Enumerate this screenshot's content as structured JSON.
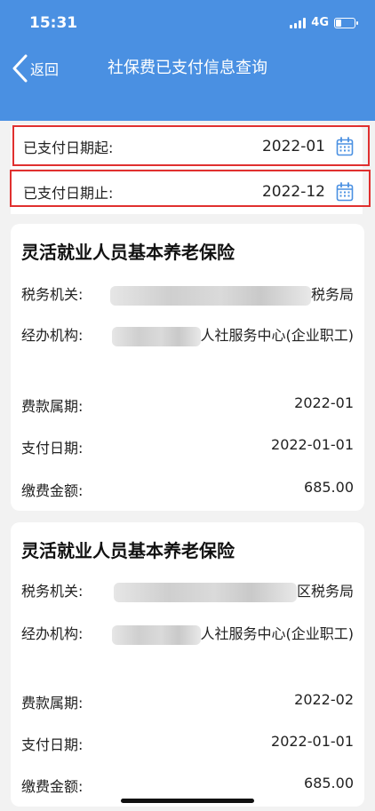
{
  "status_bar": {
    "time": "15:31",
    "network": "4G",
    "icons": [
      "signal-icon",
      "battery-icon"
    ]
  },
  "nav": {
    "back_label": "返回",
    "title": "社保费已支付信息查询",
    "back_icon": "chevron-left-icon"
  },
  "filters": {
    "start": {
      "label": "已支付日期起:",
      "value": "2022-01",
      "icon": "calendar-icon"
    },
    "end": {
      "label": "已支付日期止:",
      "value": "2022-12",
      "icon": "calendar-icon"
    }
  },
  "cards": [
    {
      "title": "灵活就业人员基本养老保险",
      "tax_office_label": "税务机关:",
      "tax_office_suffix": "税务局",
      "org_label": "经办机构:",
      "org_suffix": "人社服务中心(企业职工)",
      "period_label": "费款属期:",
      "period_value": "2022-01",
      "pay_date_label": "支付日期:",
      "pay_date_value": "2022-01-01",
      "amount_label": "缴费金额:",
      "amount_value": "685.00"
    },
    {
      "title": "灵活就业人员基本养老保险",
      "tax_office_label": "税务机关:",
      "tax_office_suffix": "区税务局",
      "org_label": "经办机构:",
      "org_suffix": "人社服务中心(企业职工)",
      "period_label": "费款属期:",
      "period_value": "2022-02",
      "pay_date_label": "支付日期:",
      "pay_date_value": "2022-01-01",
      "amount_label": "缴费金额:",
      "amount_value": "685.00"
    }
  ],
  "colors": {
    "header": "#4a90e2",
    "highlight": "#e0302f",
    "background": "#f2f2f2"
  }
}
